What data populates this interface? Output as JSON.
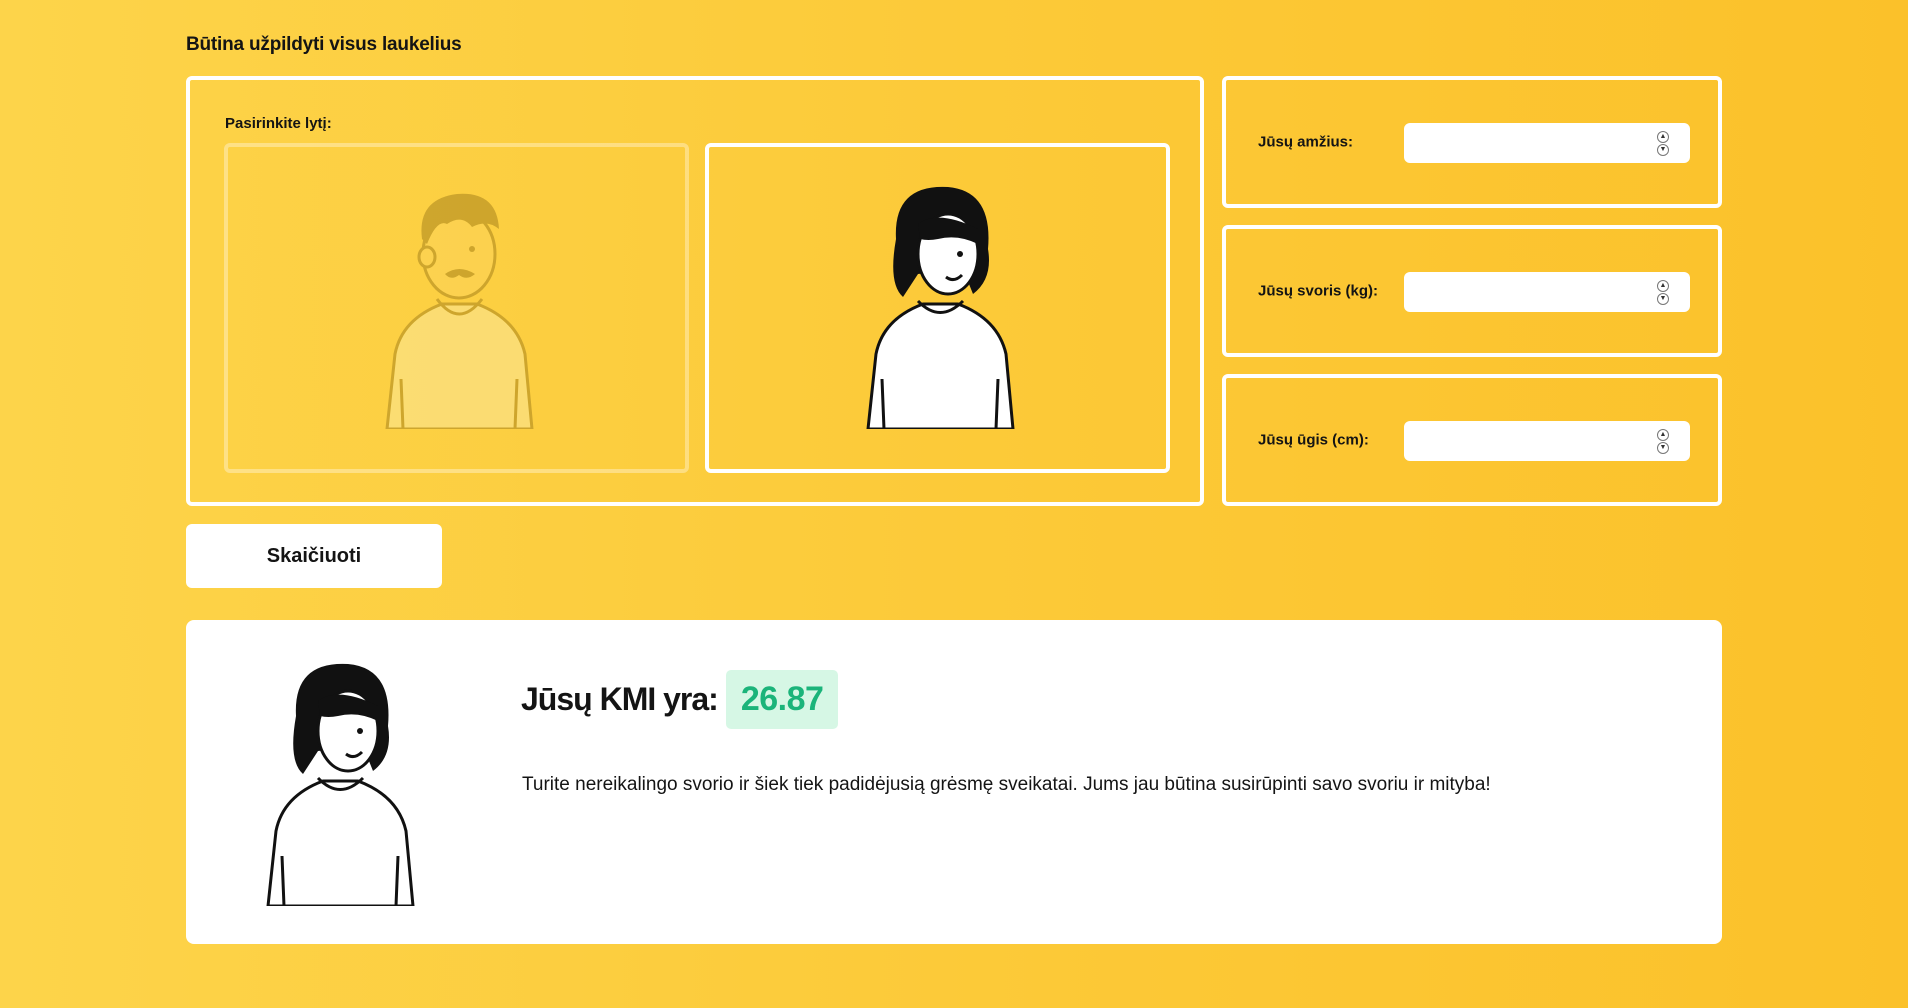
{
  "form": {
    "warning": "Būtina užpildyti visus laukelius",
    "gender_label": "Pasirinkite lytį:",
    "genders": [
      {
        "id": "male",
        "selected": false
      },
      {
        "id": "female",
        "selected": true
      }
    ],
    "fields": [
      {
        "label": "Jūsų amžius:",
        "value": ""
      },
      {
        "label": "Jūsų svoris (kg):",
        "value": ""
      },
      {
        "label": "Jūsų ūgis (cm):",
        "value": ""
      }
    ],
    "submit_label": "Skaičiuoti"
  },
  "result": {
    "title": "Jūsų KMI yra:",
    "bmi": "26.87",
    "message": "Turite nereikalingo svorio ir šiek tiek padidėjusią grėsmę sveikatai. Jums jau būtina susirūpinti savo svoriu ir mityba!",
    "avatar_icon": "woman-avatar-icon",
    "bmi_color": "#1bb47a",
    "bmi_bg": "#d6f7e5"
  },
  "colors": {
    "background_start": "#fdd44a",
    "background_end": "#fbc12a"
  }
}
